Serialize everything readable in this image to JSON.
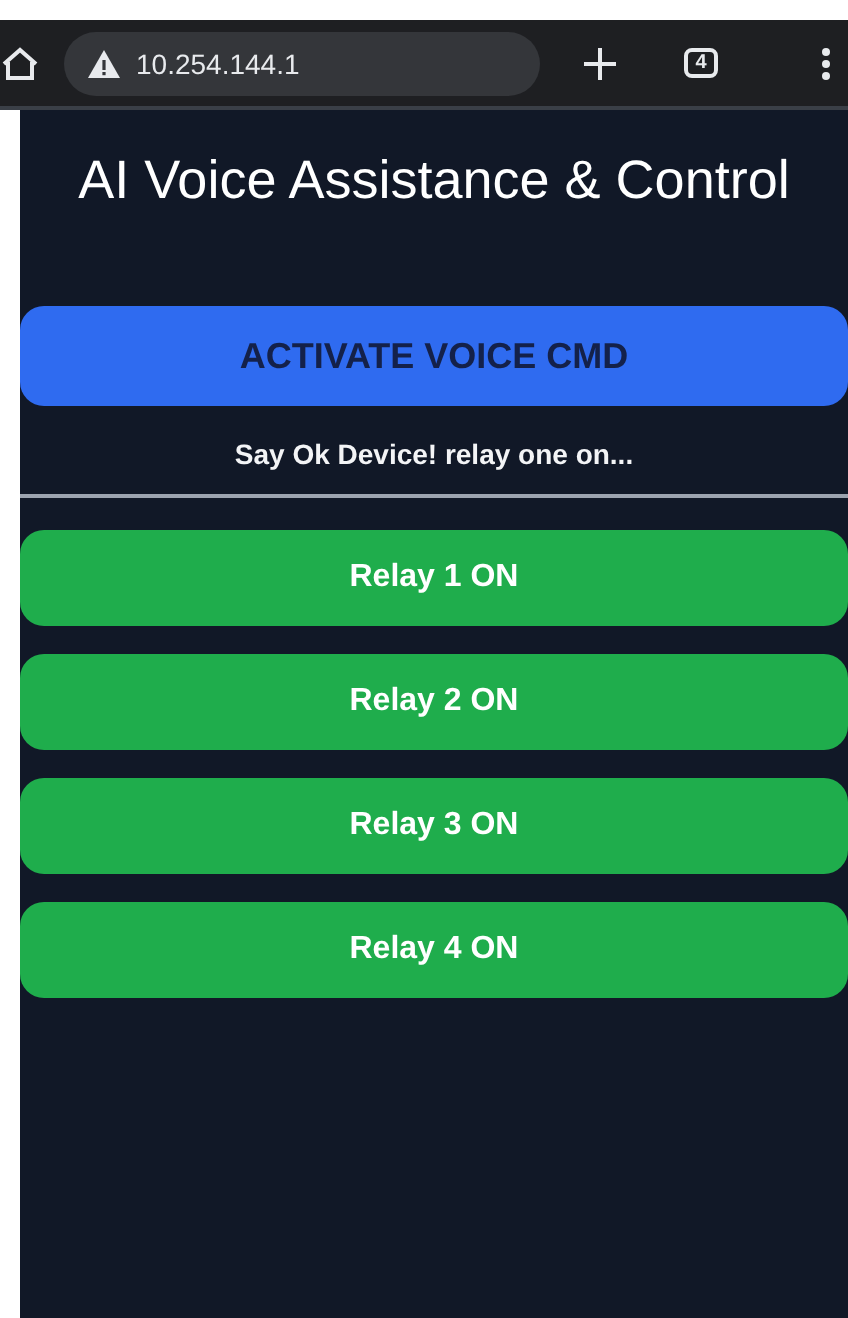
{
  "browser_bar": {
    "url": "10.254.144.1",
    "tab_count": "4"
  },
  "title": "AI Voice Assistance & Control",
  "voice_button": {
    "label": "ACTIVATE VOICE CMD"
  },
  "hint": "Say Ok Device! relay one on...",
  "relays": [
    {
      "label": "Relay 1 ON"
    },
    {
      "label": "Relay 2 ON"
    },
    {
      "label": "Relay 3 ON"
    },
    {
      "label": "Relay 4 ON"
    }
  ]
}
